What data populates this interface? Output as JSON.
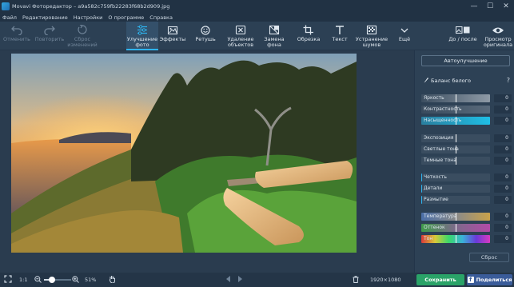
{
  "titlebar": {
    "title": "Movavi Фоторедактор – a9a582c759fb22283f68b2d909.jpg",
    "minimize": "—",
    "maximize": "☐",
    "close": "✕"
  },
  "menu": [
    "Файл",
    "Редактирование",
    "Настройки",
    "О программе",
    "Справка"
  ],
  "toolbar": {
    "undo": "Отменить",
    "redo": "Повторить",
    "reset": [
      "Сброс",
      "изменений"
    ],
    "enhance": [
      "Улучшение",
      "фото"
    ],
    "effects": "Эффекты",
    "retouch": "Ретушь",
    "remove_objects": [
      "Удаление",
      "объектов"
    ],
    "replace_bg": [
      "Замена",
      "фона"
    ],
    "crop": "Обрезка",
    "text": "Текст",
    "denoise": [
      "Устранение",
      "шумов"
    ],
    "more": "Ещё",
    "before_after": "До / после",
    "view_original": [
      "Просмотр",
      "оригинала"
    ]
  },
  "panel": {
    "auto_enhance": "Автоулучшение",
    "white_balance": "Баланс белого",
    "help": "?",
    "reset": "Сброс",
    "sliders": [
      {
        "label": "Яркость",
        "value": "0"
      },
      {
        "label": "Контрастность",
        "value": "0"
      },
      {
        "label": "Насыщенность",
        "value": "0"
      },
      {
        "label": "Экспозиция",
        "value": "0"
      },
      {
        "label": "Светлые тона",
        "value": "0"
      },
      {
        "label": "Темные тона",
        "value": "0"
      },
      {
        "label": "Четкость",
        "value": "0"
      },
      {
        "label": "Детали",
        "value": "0"
      },
      {
        "label": "Размытие",
        "value": "0"
      },
      {
        "label": "Температура",
        "value": "0"
      },
      {
        "label": "Оттенок",
        "value": "0"
      },
      {
        "label": "Тон",
        "value": "0"
      }
    ]
  },
  "status": {
    "ratio": "1:1",
    "zoom": "51%",
    "zoom_level": 0.3,
    "dimensions": "1920×1080",
    "save": "Сохранить",
    "share": "Поделиться",
    "fb": "f"
  },
  "colors": {
    "accent": "#2fb4ef",
    "save": "#2aa368",
    "share": "#3a5c9a"
  }
}
